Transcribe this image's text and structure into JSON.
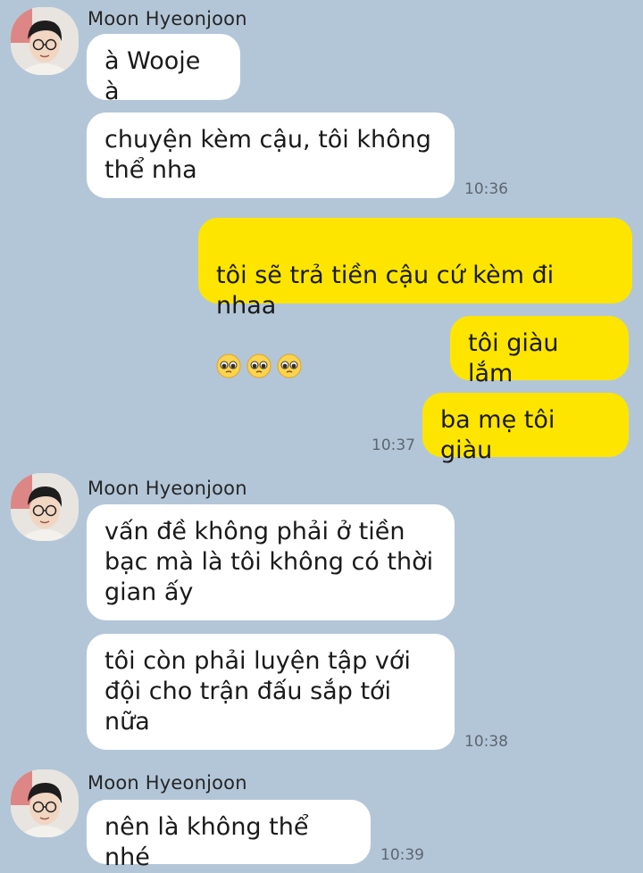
{
  "sender_name": "Moon Hyeonjoon",
  "groups": [
    {
      "messages": [
        "à Wooje à",
        "chuyện kèm cậu, tôi không\nthể nha"
      ],
      "time": "10:36"
    },
    {
      "messages": [
        "tôi sẽ trả tiền cậu cứ kèm đi nhaa",
        "tôi giàu lắm",
        "ba mẹ tôi giàu"
      ],
      "emoji": [
        "pleading-face",
        "pleading-face",
        "pleading-face"
      ],
      "time": "10:37"
    },
    {
      "messages": [
        "vấn đề không phải ở tiền\nbạc mà là tôi không có thời\ngian ấy",
        "tôi còn phải luyện tập với\nđội cho trận đấu sắp tới\nnữa"
      ],
      "time": "10:38"
    },
    {
      "messages": [
        "nên là không thể nhé"
      ],
      "time": "10:39"
    }
  ],
  "colors": {
    "background": "#b3c6d8",
    "incoming_bubble": "#ffffff",
    "outgoing_bubble": "#fee500"
  }
}
